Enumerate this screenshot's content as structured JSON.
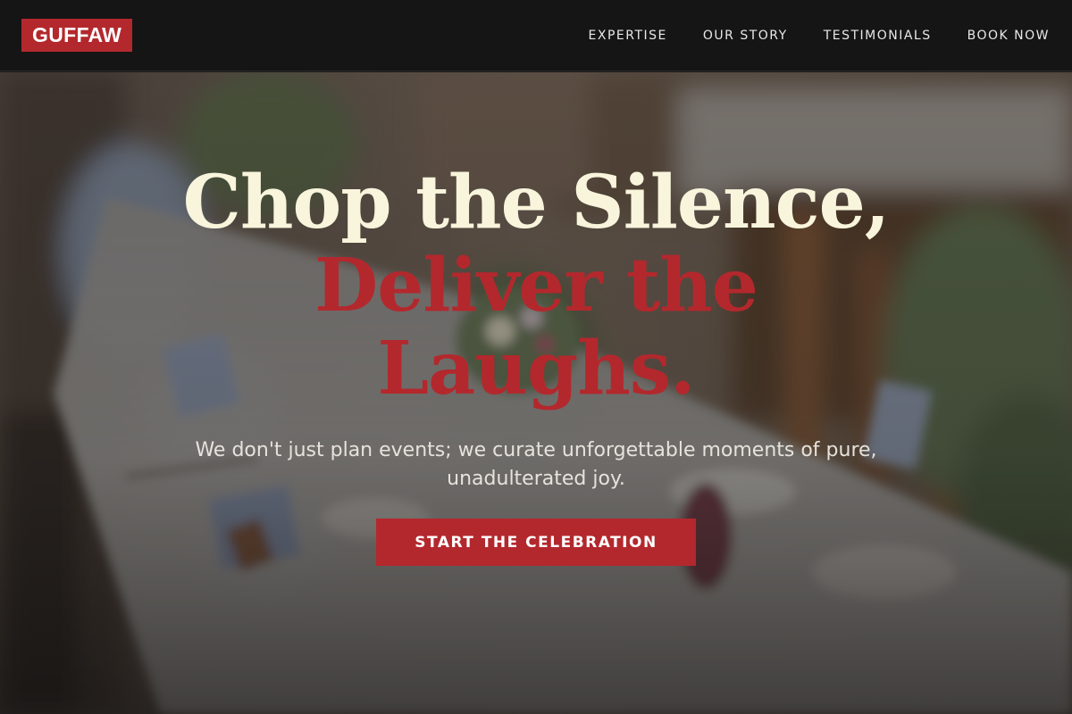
{
  "brand": {
    "logo_text": "GUFFAW",
    "accent_color": "#b3282d"
  },
  "nav": {
    "items": [
      {
        "label": "EXPERTISE"
      },
      {
        "label": "OUR STORY"
      },
      {
        "label": "TESTIMONIALS"
      },
      {
        "label": "BOOK NOW"
      }
    ]
  },
  "hero": {
    "headline_line1": "Chop the Silence,",
    "headline_line2": "Deliver the Laughs.",
    "subtitle": "We don't just plan events; we curate unforgettable moments of pure, unadulterated joy.",
    "cta_label": "START THE CELEBRATION",
    "background_image": "banquet-table-with-flowers"
  },
  "colors": {
    "headline_light": "#f8f5dc",
    "headline_accent": "#b3282d",
    "nav_bg": "#151515"
  }
}
